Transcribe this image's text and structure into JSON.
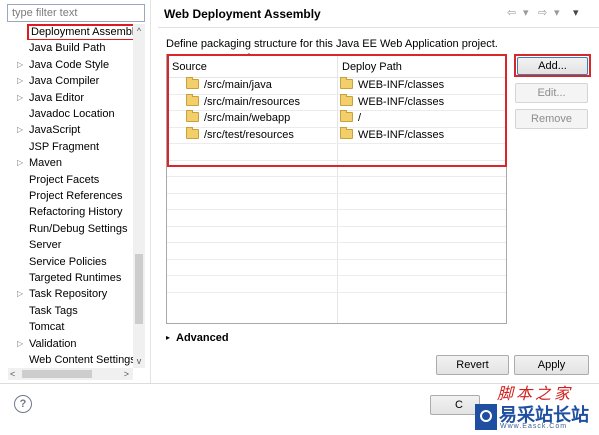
{
  "filter": {
    "placeholder": "type filter text"
  },
  "tree": {
    "items": [
      {
        "label": "Deployment Assembly",
        "arrow": "",
        "selected": true
      },
      {
        "label": "Java Build Path",
        "arrow": ""
      },
      {
        "label": "Java Code Style",
        "arrow": "▷"
      },
      {
        "label": "Java Compiler",
        "arrow": "▷"
      },
      {
        "label": "Java Editor",
        "arrow": "▷"
      },
      {
        "label": "Javadoc Location",
        "arrow": ""
      },
      {
        "label": "JavaScript",
        "arrow": "▷"
      },
      {
        "label": "JSP Fragment",
        "arrow": ""
      },
      {
        "label": "Maven",
        "arrow": "▷"
      },
      {
        "label": "Project Facets",
        "arrow": ""
      },
      {
        "label": "Project References",
        "arrow": ""
      },
      {
        "label": "Refactoring History",
        "arrow": ""
      },
      {
        "label": "Run/Debug Settings",
        "arrow": ""
      },
      {
        "label": "Server",
        "arrow": ""
      },
      {
        "label": "Service Policies",
        "arrow": ""
      },
      {
        "label": "Targeted Runtimes",
        "arrow": ""
      },
      {
        "label": "Task Repository",
        "arrow": "▷"
      },
      {
        "label": "Task Tags",
        "arrow": ""
      },
      {
        "label": "Tomcat",
        "arrow": ""
      },
      {
        "label": "Validation",
        "arrow": "▷"
      },
      {
        "label": "Web Content Settings",
        "arrow": ""
      }
    ]
  },
  "page": {
    "title": "Web Deployment Assembly",
    "description": "Define packaging structure for this Java EE Web Application project."
  },
  "nav": {
    "back": "⇦",
    "back_menu": "▾",
    "forward": "⇨",
    "forward_menu": "▾",
    "view_menu": "▾"
  },
  "table": {
    "columns": [
      "Source",
      "Deploy Path"
    ],
    "sort_indicator": "^",
    "rows": [
      {
        "source": "/src/main/java",
        "deploy": "WEB-INF/classes"
      },
      {
        "source": "/src/main/resources",
        "deploy": "WEB-INF/classes"
      },
      {
        "source": "/src/main/webapp",
        "deploy": "/"
      },
      {
        "source": "/src/test/resources",
        "deploy": "WEB-INF/classes"
      }
    ]
  },
  "buttons": {
    "add": "Add...",
    "edit": "Edit...",
    "remove": "Remove",
    "revert": "Revert",
    "apply": "Apply",
    "partial": "C"
  },
  "advanced": {
    "label": "Advanced",
    "toggle": "▸"
  },
  "help": {
    "symbol": "?"
  },
  "scroll": {
    "up": "^",
    "down": "v",
    "left": "<",
    "right": ">"
  },
  "watermark": {
    "top": "脚本之家",
    "main": "易采站长站",
    "sub": "Www.Easck.Com"
  }
}
